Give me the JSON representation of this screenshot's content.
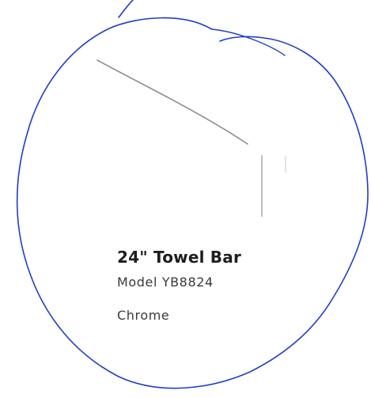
{
  "product": {
    "title": "24\" Towel Bar",
    "model": "Model YB8824",
    "finish": "Chrome"
  },
  "colors": {
    "annotation_ink": "#1f3fc4",
    "illustration_line": "#8a8a8a",
    "text": "#2a2a2a"
  }
}
